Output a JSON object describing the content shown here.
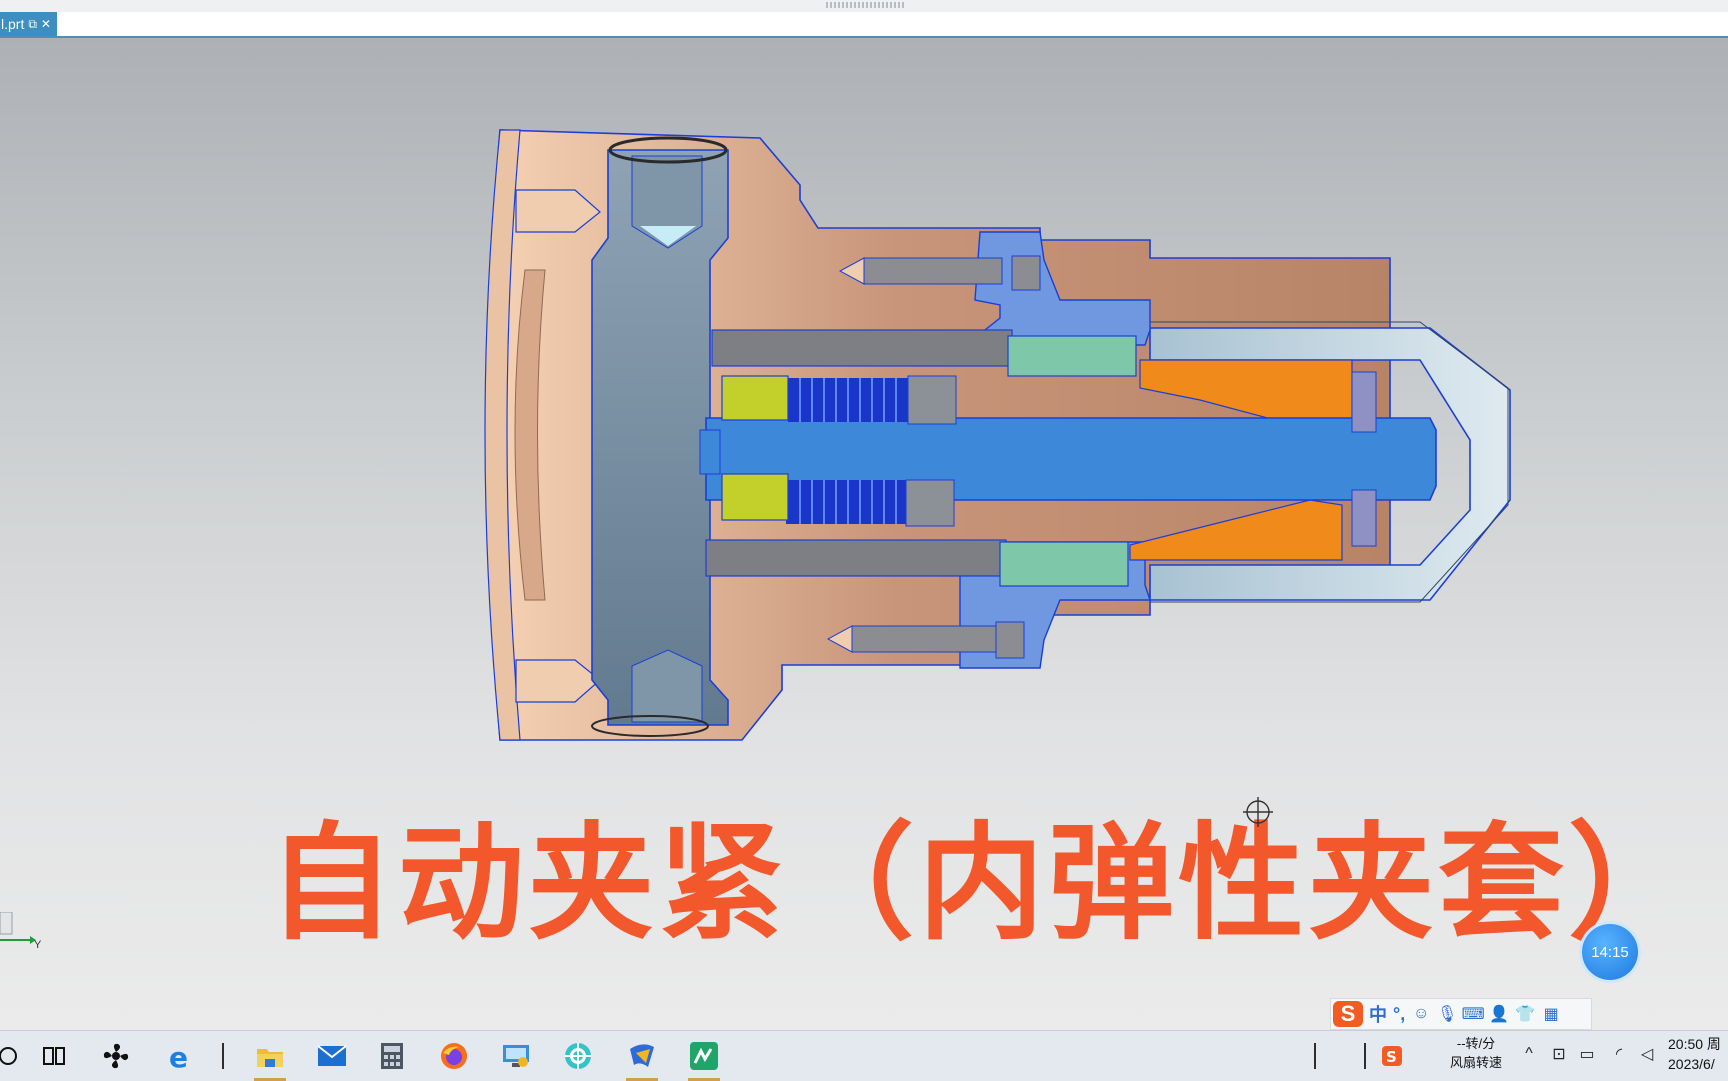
{
  "tab": {
    "file_name": "l.prt",
    "close_label": "✕"
  },
  "caption": "自动夹紧（内弹性夹套）",
  "timer": "14:15",
  "axis_label": "Y",
  "ime": {
    "logo": "S",
    "mode": "中",
    "punct": "°,"
  },
  "taskbar": {
    "fan_speed": "--转/分",
    "fan_label": "风扇转速",
    "time": "20:50 周",
    "date": "2023/6/"
  },
  "colors": {
    "body_bronze": "#c8957a",
    "section_blue": "#3d88d8",
    "caption": "#f2582c",
    "tab": "#3d8fc0"
  }
}
